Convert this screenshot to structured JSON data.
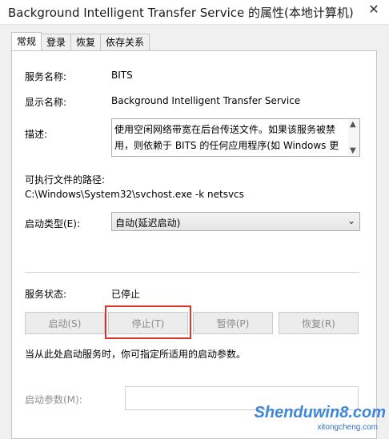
{
  "window": {
    "title": "Background Intelligent Transfer Service 的属性(本地计算机)",
    "close_glyph": "✕"
  },
  "tabs": [
    {
      "label": "常规",
      "active": true
    },
    {
      "label": "登录",
      "active": false
    },
    {
      "label": "恢复",
      "active": false
    },
    {
      "label": "依存关系",
      "active": false
    }
  ],
  "general": {
    "service_name_label": "服务名称:",
    "service_name": "BITS",
    "display_name_label": "显示名称:",
    "display_name": "Background Intelligent Transfer Service",
    "description_label": "描述:",
    "description": "使用空闲网络带宽在后台传送文件。如果该服务被禁用，则依赖于 BITS 的任何应用程序(如 Windows 更新",
    "path_label": "可执行文件的路径:",
    "path": "C:\\Windows\\System32\\svchost.exe -k netsvcs",
    "startup_type_label": "启动类型(E):",
    "startup_type_value": "自动(延迟启动)",
    "status_label": "服务状态:",
    "status_value": "已停止",
    "buttons": {
      "start": "启动(S)",
      "stop": "停止(T)",
      "pause": "暂停(P)",
      "resume": "恢复(R)"
    },
    "hint": "当从此处启动服务时，你可指定所适用的启动参数。",
    "params_label": "启动参数(M):",
    "params_value": ""
  },
  "watermark": {
    "main": "Shenduwin8.com",
    "sub": "xitongcheng.com"
  },
  "colors": {
    "highlight_border": "#e0322d",
    "watermark": "#3d86d8"
  }
}
